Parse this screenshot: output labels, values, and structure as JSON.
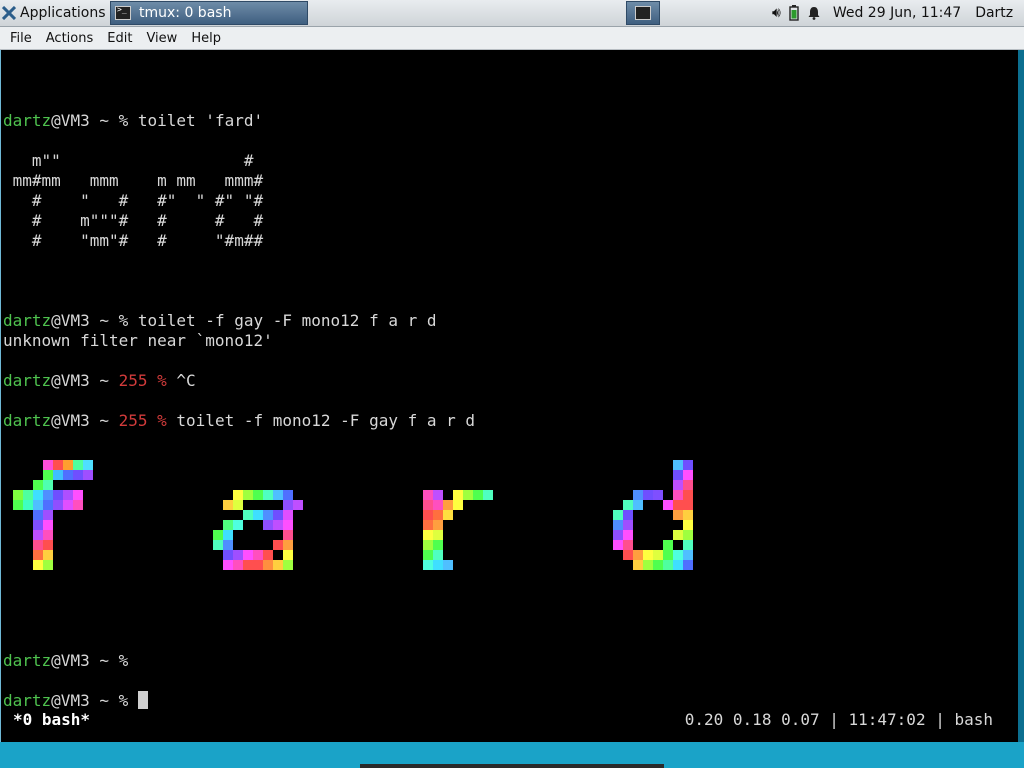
{
  "panel": {
    "applications": "Applications",
    "task_label": "tmux: 0 bash",
    "clock": "Wed 29 Jun, 11:47",
    "user": "Dartz",
    "icons": [
      "applications-icon",
      "terminal-icon",
      "volume-icon",
      "battery-icon",
      "notification-icon"
    ]
  },
  "menubar": {
    "file": "File",
    "actions": "Actions",
    "edit": "Edit",
    "view": "View",
    "help": "Help"
  },
  "terminal": {
    "lines": [
      {
        "prompt_user": "dartz",
        "prompt_host": "@VM3 ~ ",
        "prompt_code": "",
        "prompt_sym": "% ",
        "cmd": "toilet 'fard'"
      },
      {
        "text": "   m\"\"                   #"
      },
      {
        "text": " mm#mm   mmm    m mm   mmm#"
      },
      {
        "text": "   #    \"   #   #\"  \" #\" \"#"
      },
      {
        "text": "   #    m\"\"\"#   #     #   #"
      },
      {
        "text": "   #    \"mm\"#   #     \"#m##"
      },
      {
        "prompt_user": "dartz",
        "prompt_host": "@VM3 ~ ",
        "prompt_code": "",
        "prompt_sym": "% ",
        "cmd": "toilet -f gay -F mono12 f a r d"
      },
      {
        "text": "unknown filter near `mono12'"
      },
      {
        "prompt_user": "dartz",
        "prompt_host": "@VM3 ~ ",
        "prompt_code": "255 ",
        "prompt_sym": "% ",
        "cmd": "^C"
      },
      {
        "prompt_user": "dartz",
        "prompt_host": "@VM3 ~ ",
        "prompt_code": "255 ",
        "prompt_sym": "% ",
        "cmd": "toilet -f mono12 -F gay f a r d"
      },
      {
        "prompt_user": "dartz",
        "prompt_host": "@VM3 ~ ",
        "prompt_code": "",
        "prompt_sym": "% ",
        "cmd": ""
      },
      {
        "prompt_user": "dartz",
        "prompt_host": "@VM3 ~ ",
        "prompt_code": "",
        "prompt_sym": "% ",
        "cmd": ""
      }
    ],
    "tmux_status_left": "*0 bash*",
    "tmux_status_right": "0.20 0.18 0.07 | 11:47:02 | bash",
    "rainbow_art": "f a r d",
    "colors": {
      "prompt": "#4fc34f",
      "exit_code": "#d23b3b",
      "background": "#000000"
    }
  }
}
